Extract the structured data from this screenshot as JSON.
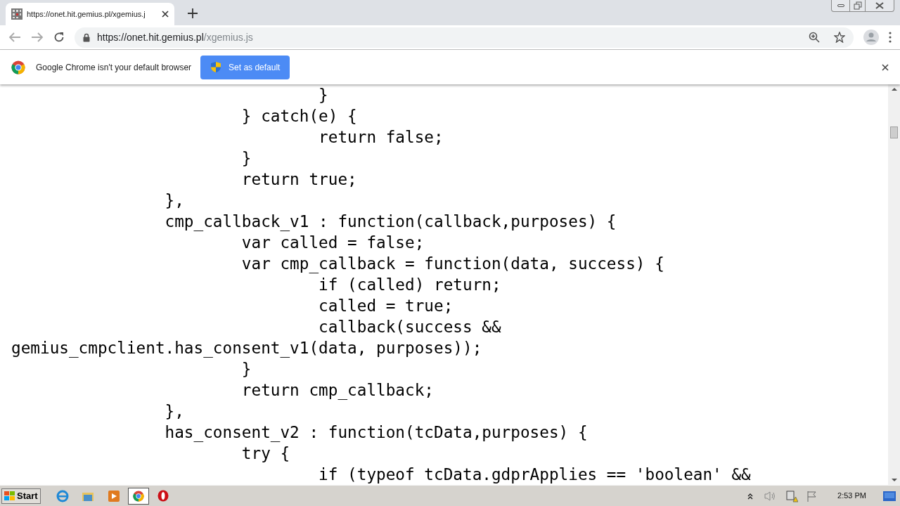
{
  "tab": {
    "title": "https://onet.hit.gemius.pl/xgemius.j",
    "selected": true
  },
  "address_bar": {
    "host": "https://onet.hit.gemius.pl",
    "path": "/xgemius.js"
  },
  "infobar": {
    "message": "Google Chrome isn't your default browser",
    "button": "Set as default"
  },
  "code_lines": [
    "\t\t\t\t}",
    "\t\t\t} catch(e) {",
    "\t\t\t\treturn false;",
    "\t\t\t}",
    "\t\t\treturn true;",
    "\t\t},",
    "\t\tcmp_callback_v1 : function(callback,purposes) {",
    "\t\t\tvar called = false;",
    "\t\t\tvar cmp_callback = function(data, success) {",
    "\t\t\t\tif (called) return;",
    "\t\t\t\tcalled = true;",
    "\t\t\t\tcallback(success &&",
    "gemius_cmpclient.has_consent_v1(data, purposes));",
    "\t\t\t}",
    "\t\t\treturn cmp_callback;",
    "\t\t},",
    "\t\thas_consent_v2 : function(tcData,purposes) {",
    "\t\t\ttry {",
    "\t\t\t\tif (typeof tcData.gdprApplies == 'boolean' &&"
  ],
  "taskbar": {
    "start": "Start",
    "clock": "2:53 PM"
  }
}
